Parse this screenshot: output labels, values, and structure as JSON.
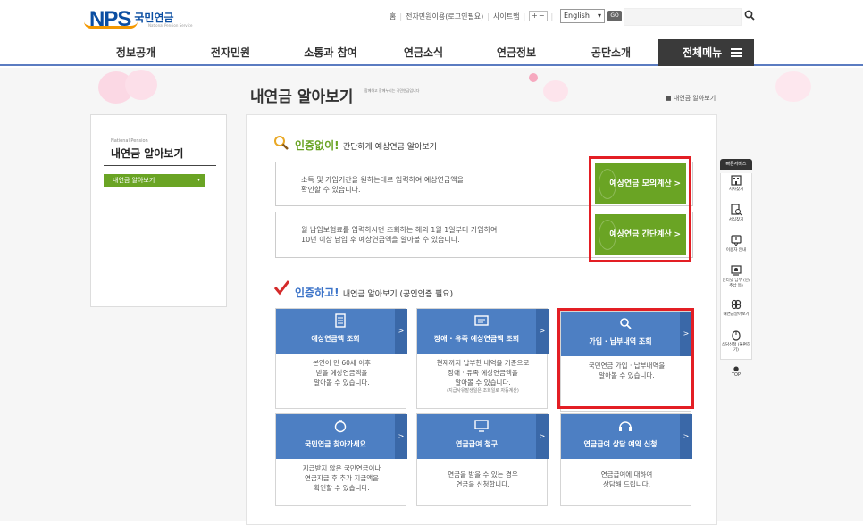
{
  "header": {
    "logo_nps": "NPS",
    "logo_kr": "국민연금",
    "logo_sub": "National Pension Service",
    "links": [
      "홈",
      "전자민원이용(로그인필요)",
      "사이트맵"
    ],
    "font_buttons": [
      "+",
      "−"
    ],
    "language": "English",
    "go_label": "GO"
  },
  "gnb": {
    "items": [
      "정보공개",
      "전자민원",
      "소통과 참여",
      "연금소식",
      "연금정보",
      "공단소개"
    ],
    "all_menu": "전체메뉴"
  },
  "page": {
    "title": "내연금 알아보기",
    "subtitle": "함께하고 함께누리는 국민연금입니다",
    "breadcrumb": "내연금 알아보기"
  },
  "sidebar": {
    "en_title": "National Pension",
    "title": "내연금 알아보기",
    "menu_item": "내연금 알아보기"
  },
  "section1": {
    "highlight": "인증없이!",
    "rest": "간단하게 예상연금 알아보기",
    "rows": [
      {
        "text1": "소득 및 가입기간을 원하는대로 입력하여 예상연금액을",
        "text2": "확인할 수 있습니다.",
        "button": "예상연금 모의계산"
      },
      {
        "text1": "월 납입보험료를 입력하시면 조회하는 해의 1월 1일부터 가입하여",
        "text2": "10년 이상 납입 후 예상연금액을 알아볼 수 있습니다.",
        "button": "예상연금 간단계산"
      }
    ]
  },
  "section2": {
    "highlight": "인증하고!",
    "rest": "내연금 알아보기 (공인인증 필요)",
    "cards": [
      {
        "title": "예상연금액 조회",
        "lines": [
          "본인이 만 60세 이후",
          "받을 예상연금액을",
          "알아볼 수 있습니다."
        ],
        "note": ""
      },
      {
        "title": "장애 · 유족 예상연금액 조회",
        "lines": [
          "현재까지 납부한 내역을 기준으로",
          "장애 · 유족 예상연금액을",
          "알아볼 수 있습니다."
        ],
        "note": "(지급사유발생일은 조회일로 자동계산)"
      },
      {
        "title": "가입 · 납부내역 조회",
        "lines": [
          "국민연금 가입 · 납부내역을",
          "알아볼 수 있습니다."
        ],
        "note": ""
      },
      {
        "title": "국민연금 찾아가세요",
        "lines": [
          "지급받지 않은 국민연금이나",
          "연금지급 후 추가 지급액을",
          "확인할 수 있습니다."
        ],
        "note": ""
      },
      {
        "title": "연금급여 청구",
        "lines": [
          "연금을 받을 수 있는 경우",
          "연금을 신청합니다."
        ],
        "note": ""
      },
      {
        "title": "연금급여 상담 예약 신청",
        "lines": [
          "연금급여에 대하여",
          "상담해 드립니다."
        ],
        "note": ""
      }
    ]
  },
  "quick_menu": {
    "title": "빠른서비스",
    "items": [
      "지사찾기",
      "서식찾기",
      "이용자 안내",
      "인터넷 납부 (반/추납 등)",
      "내연금알아보기",
      "상담신청 (불편하기)"
    ],
    "top": "TOP"
  },
  "colors": {
    "green": "#6aa424",
    "blue_card": "#4d7fc3",
    "highlight_red": "#e31e24",
    "nav_underline": "#5b7cc1"
  }
}
